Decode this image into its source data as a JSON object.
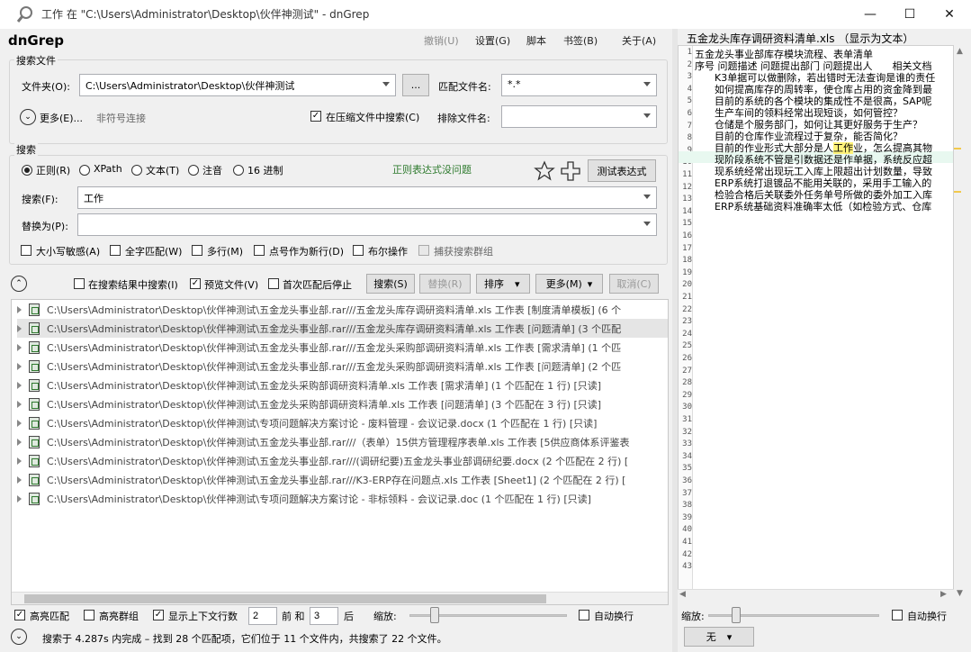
{
  "window": {
    "title": "工作 在 \"C:\\Users\\Administrator\\Desktop\\伙伴神测试\" - dnGrep",
    "minimize": "—",
    "maximize": "☐",
    "close": "✕"
  },
  "app_name": "dnGrep",
  "menu": {
    "undo": "撤销(U)",
    "settings": "设置(G)",
    "script": "脚本",
    "bookmarks": "书签(B)",
    "about": "关于(A)"
  },
  "search_files": {
    "group_title": "搜索文件",
    "folder_label": "文件夹(O):",
    "folder_value": "C:\\Users\\Administrator\\Desktop\\伙伴神测试",
    "browse": "...",
    "pattern_label": "匹配文件名:",
    "pattern_value": "*.*",
    "more": "更多(E)...",
    "symlink": "非符号连接",
    "search_archives": "在压缩文件中搜索(C)",
    "exclude_label": "排除文件名:",
    "exclude_value": ""
  },
  "search": {
    "group_title": "搜索",
    "modes": [
      "正则(R)",
      "XPath",
      "文本(T)",
      "注音",
      "16 进制"
    ],
    "regex_ok": "正则表达式没问题",
    "test_regex": "测试表达式",
    "search_label": "搜索(F):",
    "search_value": "工作",
    "replace_label": "替换为(P):",
    "replace_value": "",
    "options": [
      "大小写敏感(A)",
      "全字匹配(W)",
      "多行(M)",
      "点号作为新行(D)",
      "布尔操作",
      "捕获搜索群组"
    ]
  },
  "actions": {
    "search_in_results": "在搜索结果中搜索(I)",
    "preview_file": "预览文件(V)",
    "stop_first": "首次匹配后停止",
    "search": "搜索(S)",
    "replace": "替换(R)",
    "sort": "排序",
    "more": "更多(M)",
    "cancel": "取消(C)"
  },
  "results": [
    "C:\\Users\\Administrator\\Desktop\\伙伴神测试\\五金龙头事业部.rar///五金龙头库存调研资料清单.xls 工作表 [制度清单模板] (6 个",
    "C:\\Users\\Administrator\\Desktop\\伙伴神测试\\五金龙头事业部.rar///五金龙头库存调研资料清单.xls 工作表 [问题清单] (3 个匹配",
    "C:\\Users\\Administrator\\Desktop\\伙伴神测试\\五金龙头事业部.rar///五金龙头采购部调研资料清单.xls 工作表 [需求清单] (1 个匹",
    "C:\\Users\\Administrator\\Desktop\\伙伴神测试\\五金龙头事业部.rar///五金龙头采购部调研资料清单.xls 工作表 [问题清单] (2 个匹",
    "C:\\Users\\Administrator\\Desktop\\伙伴神测试\\五金龙头采购部调研资料清单.xls 工作表 [需求清单] (1 个匹配在 1 行) [只读]",
    "C:\\Users\\Administrator\\Desktop\\伙伴神测试\\五金龙头采购部调研资料清单.xls 工作表 [问题清单] (3 个匹配在 3 行) [只读]",
    "C:\\Users\\Administrator\\Desktop\\伙伴神测试\\专项问题解决方案讨论 - 废料管理 - 会议记录.docx (1 个匹配在 1 行) [只读]",
    "C:\\Users\\Administrator\\Desktop\\伙伴神测试\\五金龙头事业部.rar///（表单）15供方管理程序表单.xls 工作表 [5供应商体系评鉴表",
    "C:\\Users\\Administrator\\Desktop\\伙伴神测试\\五金龙头事业部.rar///(调研纪要)五金龙头事业部调研纪要.docx (2 个匹配在 2 行) [",
    "C:\\Users\\Administrator\\Desktop\\伙伴神测试\\五金龙头事业部.rar///K3-ERP存在问题点.xls 工作表 [Sheet1] (2 个匹配在 2 行) [",
    "C:\\Users\\Administrator\\Desktop\\伙伴神测试\\专项问题解决方案讨论 - 非标领料 - 会议记录.doc (1 个匹配在 1 行) [只读]"
  ],
  "bottom": {
    "highlight_matches": "高亮匹配",
    "highlight_groups": "高亮群组",
    "show_context": "显示上下文行数",
    "before_value": "2",
    "before_label": "前 和",
    "after_value": "3",
    "after_label": "后",
    "zoom_label": "缩放:",
    "word_wrap": "自动换行",
    "status": "搜索于 4.287s 内完成 – 找到 28 个匹配项，它们位于 11 个文件内，共搜索了 22 个文件。"
  },
  "preview": {
    "title": "五金龙头库存调研资料清单.xls （显示为文本）",
    "lines": [
      "五金龙头事业部库存模块流程、表单清单",
      "序号 问题描述 问题提出部门 问题提出人　　相关文档",
      "　　K3单据可以做删除，若出错时无法查询是谁的责任",
      "　　如何提高库存的周转率，使仓库占用的资金降到最",
      "　　目前的系统的各个模块的集成性不是很高，SAP呢",
      "　　生产车间的领料经常出现短谈，如何管控？",
      "　　仓储是个服务部门，如何让其更好服务于生产？",
      "　　目前的仓库作业流程过于复杂，能否简化？",
      "　　目前的作业形式大部分是人工作业，怎么提高其物",
      "　　现阶段系统不管是引数据还是作单据，系统反应超",
      "　　现系统经常出现玩工入库上限超出计划数量，导致",
      "　　ERP系统打退镀品不能用关联的，采用手工输入的",
      "　　检验合格后关联委外任务单号所做的委外加工入库",
      "　　ERP系统基础资料准确率太低（如检验方式、仓库"
    ],
    "line_count": 43,
    "zoom_label": "缩放:",
    "word_wrap": "自动换行",
    "highlight_mode": "无"
  }
}
